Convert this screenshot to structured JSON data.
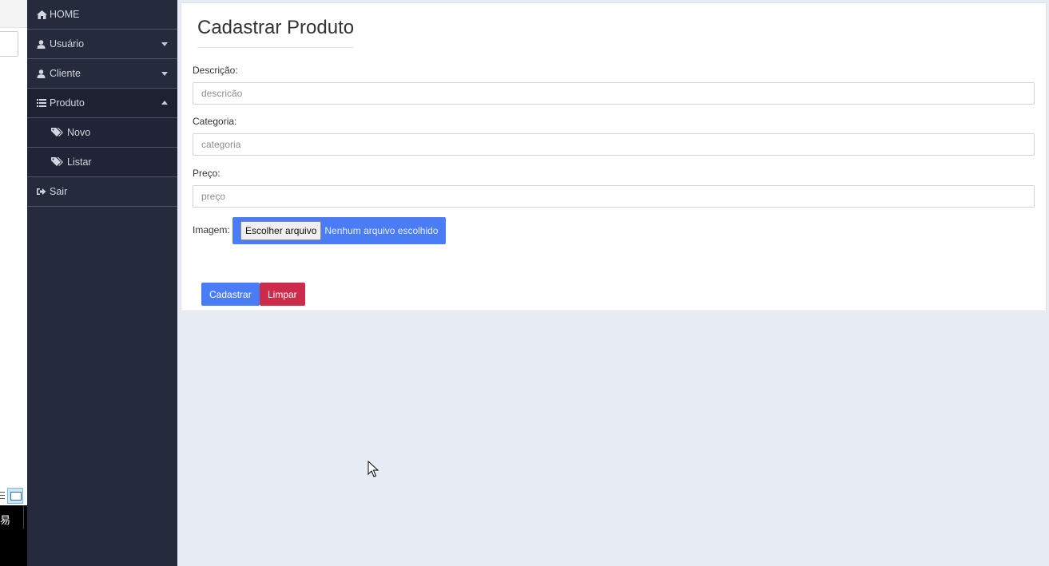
{
  "sidebar": {
    "items": [
      {
        "label": "HOME",
        "icon": "home-icon"
      },
      {
        "label": "Usuário",
        "icon": "user-icon",
        "caret": "down"
      },
      {
        "label": "Cliente",
        "icon": "user-icon",
        "caret": "down"
      },
      {
        "label": "Produto",
        "icon": "list-icon",
        "caret": "up",
        "active": true
      },
      {
        "label": "Novo",
        "icon": "tags-icon",
        "sub": true
      },
      {
        "label": "Listar",
        "icon": "tags-icon",
        "sub": true
      },
      {
        "label": "Sair",
        "icon": "sign-out-icon"
      }
    ]
  },
  "form": {
    "title": "Cadastrar Produto",
    "descricao_label": "Descrição:",
    "descricao_placeholder": "descricão",
    "categoria_label": "Categoria:",
    "categoria_placeholder": "categoria",
    "preco_label": "Preço:",
    "preco_placeholder": "preço",
    "imagem_label": "Imagem:",
    "file_button": "Escolher arquivo",
    "file_status": "Nenhum arquivo escolhido",
    "submit_label": "Cadastrar",
    "clear_label": "Limpar"
  },
  "colors": {
    "sidebar_bg": "#252a3d",
    "primary": "#4a7cf6",
    "danger": "#cc2c4a",
    "page_bg": "#e8ecf4"
  }
}
